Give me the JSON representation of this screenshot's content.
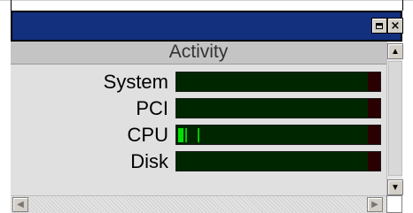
{
  "titlebar": {
    "title": "",
    "maximize_icon": "maximize-icon",
    "close_icon": "close-icon",
    "close_glyph": "×"
  },
  "panel": {
    "header": "Activity"
  },
  "rows": [
    {
      "label": "System"
    },
    {
      "label": "PCI"
    },
    {
      "label": "CPU"
    },
    {
      "label": "Disk"
    }
  ],
  "scrollbar": {
    "up_glyph": "▲",
    "down_glyph": "▼",
    "left_glyph": "◀",
    "right_glyph": "▶"
  },
  "colors": {
    "titlebar": "#13307e",
    "bar_background": "#002600",
    "bar_end": "#2a0000",
    "activity": "#00e000"
  }
}
